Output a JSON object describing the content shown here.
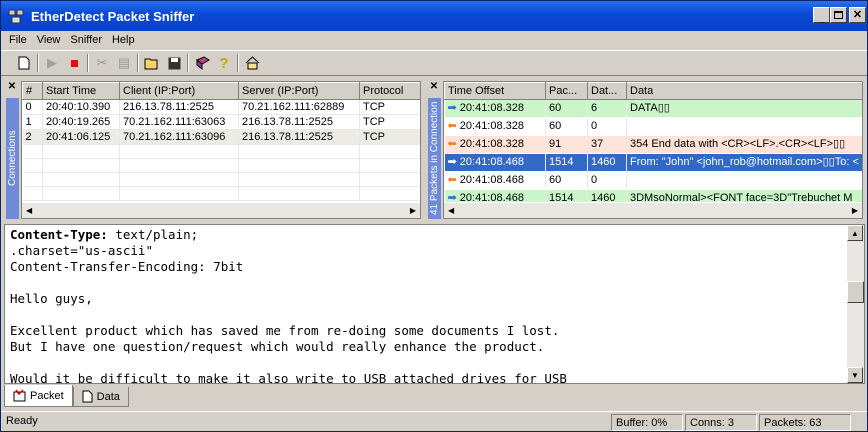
{
  "window": {
    "title": "EtherDetect Packet Sniffer"
  },
  "menu": [
    "File",
    "View",
    "Sniffer",
    "Help"
  ],
  "toolbar": {
    "icons": [
      "new-icon",
      "start-icon",
      "stop-icon",
      "filter-icon",
      "options-icon",
      "open-icon",
      "save-icon",
      "book-icon",
      "help-icon",
      "home-icon"
    ]
  },
  "connections": {
    "side_label": "Connections",
    "columns": [
      "#",
      "Start Time",
      "Client (IP:Port)",
      "Server (IP:Port)",
      "Protocol"
    ],
    "rows": [
      [
        "0",
        "20:40:10.390",
        "216.13.78.11:2525",
        "70.21.162.111:62889",
        "TCP"
      ],
      [
        "1",
        "20:40:19.265",
        "70.21.162.111:63063",
        "216.13.78.11:2525",
        "TCP"
      ],
      [
        "2",
        "20:41:06.125",
        "70.21.162.111:63096",
        "216.13.78.11:2525",
        "TCP"
      ]
    ]
  },
  "packets": {
    "side_label": "41 Packets in Connection",
    "columns": [
      "Time Offset",
      "Pac...",
      "Dat...",
      "Data"
    ],
    "rows": [
      {
        "dir": "right",
        "style": "green",
        "time": "20:41:08.328",
        "pac": "60",
        "dat": "6",
        "data": "DATA▯▯"
      },
      {
        "dir": "left",
        "style": "white",
        "time": "20:41:08.328",
        "pac": "60",
        "dat": "0",
        "data": ""
      },
      {
        "dir": "left",
        "style": "peach",
        "time": "20:41:08.328",
        "pac": "91",
        "dat": "37",
        "data": "354 End data with <CR><LF>.<CR><LF>▯▯"
      },
      {
        "dir": "right",
        "style": "blue",
        "time": "20:41:08.468",
        "pac": "1514",
        "dat": "1460",
        "data": "From: \"John\" <john_rob@hotmail.com>▯▯To: <"
      },
      {
        "dir": "left",
        "style": "white",
        "time": "20:41:08.468",
        "pac": "60",
        "dat": "0",
        "data": ""
      },
      {
        "dir": "right",
        "style": "green",
        "time": "20:41:08.468",
        "pac": "1514",
        "dat": "1460",
        "data": "3DMsoNormal><FONT face=3D\"Trebuchet M"
      }
    ]
  },
  "content": {
    "lines": [
      {
        "bold": "Content-Type:",
        "rest": " text/plain;"
      },
      {
        "bold": "",
        "rest": ".charset=\"us-ascii\""
      },
      {
        "bold": "",
        "rest": "Content-Transfer-Encoding: 7bit"
      },
      {
        "bold": "",
        "rest": ""
      },
      {
        "bold": "",
        "rest": "Hello guys,"
      },
      {
        "bold": "",
        "rest": ""
      },
      {
        "bold": "",
        "rest": "Excellent product which has saved me from re-doing some documents I lost."
      },
      {
        "bold": "",
        "rest": "But I have one question/request which would really enhance the product."
      },
      {
        "bold": "",
        "rest": ""
      },
      {
        "bold": "",
        "rest": "Would it be difficult to make it also write to USB attached drives for USB"
      }
    ]
  },
  "tabs": [
    {
      "label": "Packet",
      "active": true
    },
    {
      "label": "Data",
      "active": false
    }
  ],
  "status": {
    "ready": "Ready",
    "buffer": "Buffer: 0%",
    "conns": "Conns: 3",
    "packets": "Packets: 63"
  }
}
